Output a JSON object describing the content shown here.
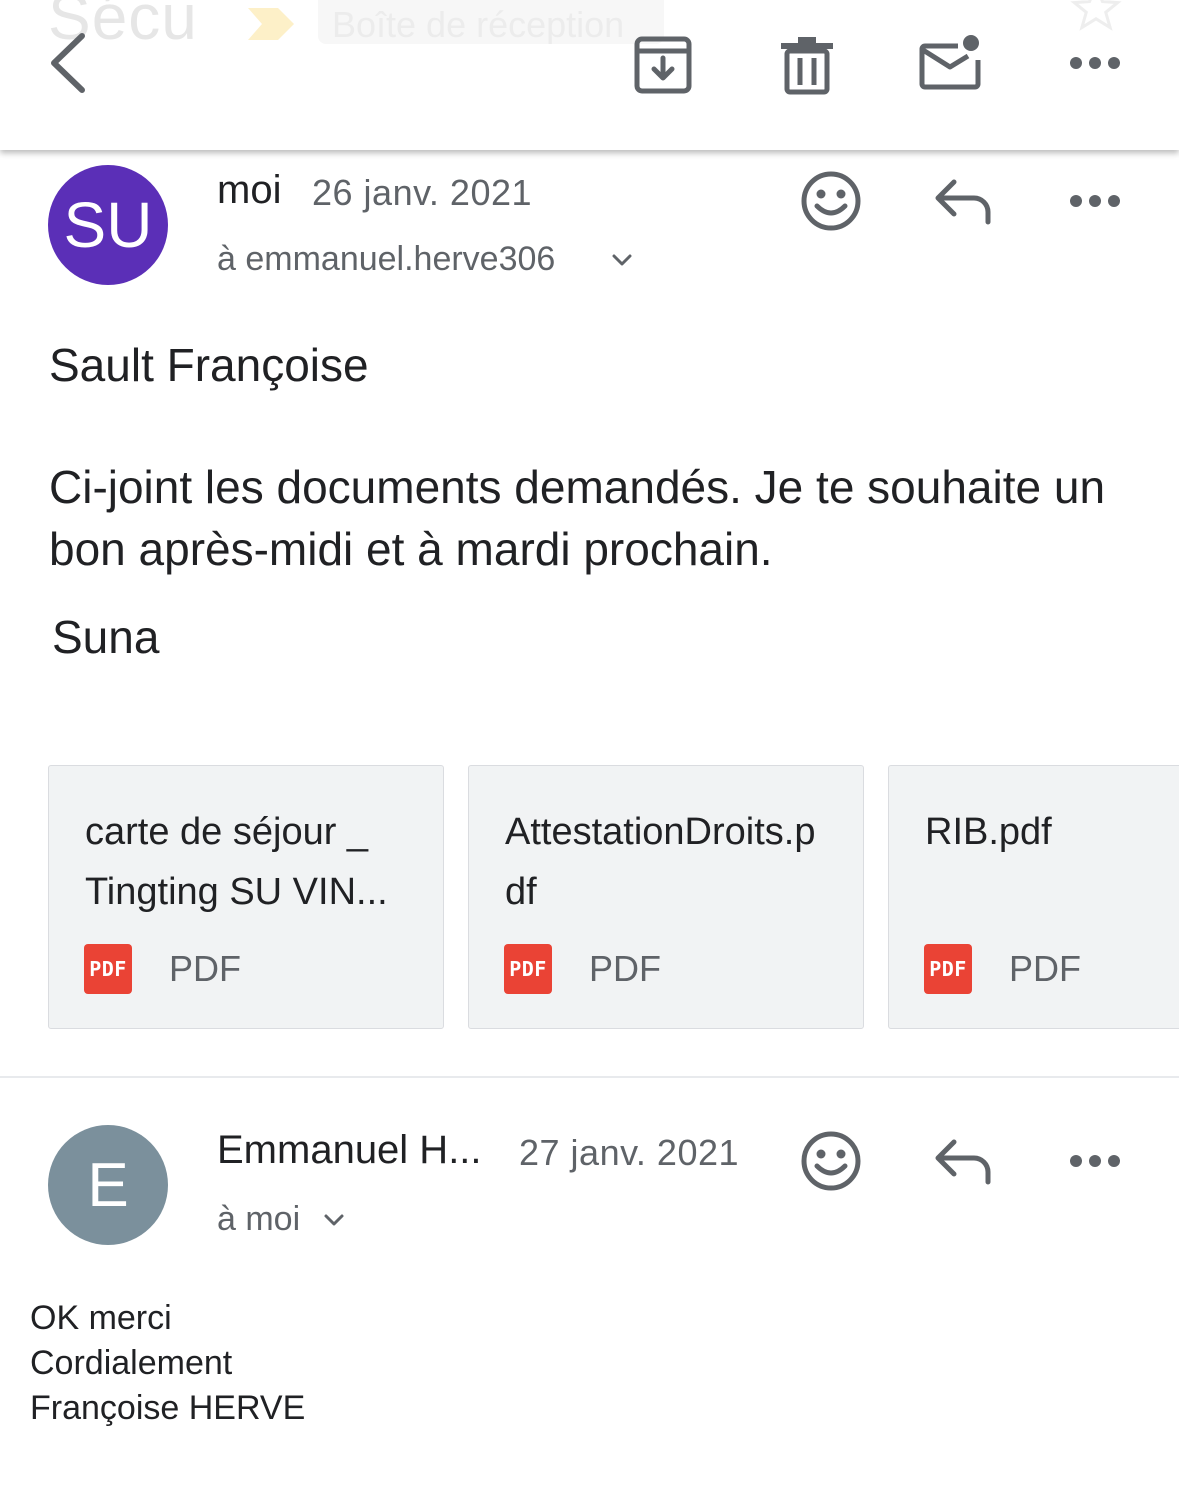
{
  "toolbar": {
    "ghost_subject": "Sécu",
    "ghost_label": "Boîte de réception"
  },
  "messages": [
    {
      "avatar_initials": "SU",
      "avatar_color": "#5b2fb7",
      "sender": "moi",
      "date": "26 janv. 2021",
      "recipient": "à emmanuel.herve306",
      "greeting": "Sault Françoise",
      "paragraph": "Ci-joint les documents demandés. Je te souhaite un bon après-midi et à mardi prochain.",
      "signature": "Suna",
      "attachments": [
        {
          "name": "carte de séjour _ Tingting SU VIN...",
          "badge": "PDF",
          "type": "PDF"
        },
        {
          "name": "AttestationDroits.pdf",
          "badge": "PDF",
          "type": "PDF"
        },
        {
          "name": "RIB.pdf",
          "badge": "PDF",
          "type": "PDF"
        }
      ]
    },
    {
      "avatar_initials": "E",
      "avatar_color": "#7b909c",
      "sender": "Emmanuel H...",
      "date": "27 janv. 2021",
      "recipient": "à moi",
      "body_lines": [
        "OK merci",
        "Cordialement",
        "Françoise HERVE"
      ]
    }
  ],
  "icons": {
    "back": "back-arrow-icon",
    "archive": "archive-icon",
    "delete": "trash-icon",
    "mark_unread": "mark-unread-icon",
    "more": "more-horizontal-icon",
    "emoji": "emoji-reaction-icon",
    "reply": "reply-icon",
    "chevron": "chevron-down-icon"
  },
  "colors": {
    "pdf_red": "#ea4335",
    "icon_gray": "#5f6368",
    "text": "#202124"
  }
}
